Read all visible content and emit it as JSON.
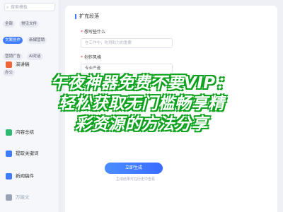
{
  "sidebar": {
    "search_placeholder": "搜索模板",
    "chips": [
      {
        "label": "全部",
        "active": false
      },
      {
        "label": "常见文件",
        "active": false
      },
      {
        "label": "文案创作",
        "active": true
      },
      {
        "label": "新媒营销",
        "active": false
      },
      {
        "label": "营销广告",
        "active": false
      },
      {
        "label": "AI对话",
        "active": false
      },
      {
        "label": "办公",
        "active": false
      }
    ],
    "items": [
      {
        "label": "演讲稿",
        "icon": "speech-icon",
        "color": "#f0643c"
      },
      {
        "label": "内容总结",
        "icon": "summary-icon",
        "color": "#2eb872"
      },
      {
        "label": "提取关键词",
        "icon": "keyword-icon",
        "color": "#3f7cff"
      },
      {
        "label": "新闻稿件",
        "icon": "news-icon",
        "color": "#3f7cff"
      },
      {
        "label": "万能文",
        "icon": "doc-icon",
        "color": "#9aa3b5"
      }
    ]
  },
  "main": {
    "card_title": "扩充段落",
    "field1_label": "想写些什么",
    "field1_placeholder": "在工作中，吃得助力的重要",
    "field2_label": "创作风格",
    "field2_value": "专业严谨",
    "generate_label": "立即生成",
    "generate_hint": "生成结果可在历史中查看"
  },
  "overlay": {
    "line1": "午夜神器免费不要VIP：",
    "line2": "轻松获取无门槛畅享精",
    "line3": "彩资源的方法分享"
  },
  "colors": {
    "accent": "#3f7cff",
    "overlay_outline": "#0ea21e"
  }
}
